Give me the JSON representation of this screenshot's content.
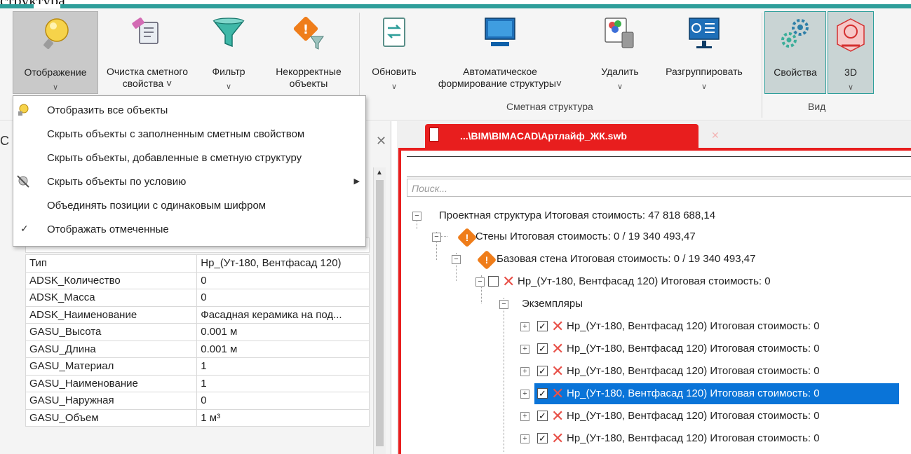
{
  "doc": {
    "partial_text": "структура"
  },
  "ribbon": {
    "buttons": [
      {
        "label": "Отображение",
        "icon": "lightbulb-icon"
      },
      {
        "label": "Очистка сметного",
        "label2": "свойства ˅",
        "icon": "eraser-icon"
      },
      {
        "label": "Фильтр",
        "icon": "filter-icon"
      },
      {
        "label": "Некорректные",
        "label2": "объекты",
        "icon": "warning-filter-icon"
      },
      {
        "label": "Обновить",
        "icon": "refresh-icon"
      },
      {
        "label": "Автоматическое",
        "label2": "формирование структуры˅",
        "icon": "monitor-icon"
      },
      {
        "label": "Удалить",
        "icon": "delete-icon"
      },
      {
        "label": "Разгруппировать",
        "icon": "ungroup-icon"
      },
      {
        "label": "Свойства",
        "icon": "gears-icon"
      },
      {
        "label": "3D",
        "icon": "3d-model-icon"
      }
    ],
    "groups": {
      "estimate_structure": "Сметная структура",
      "view": "Вид"
    }
  },
  "menu": {
    "items": [
      {
        "label": "Отобразить все объекты",
        "icon": "show-all-icon"
      },
      {
        "label": "Скрыть объекты с заполненным сметным свойством"
      },
      {
        "label": "Скрыть объекты, добавленные в сметную структуру"
      },
      {
        "label": "Скрыть объекты по условию",
        "icon": "hide-by-condition-icon",
        "submenu": true
      },
      {
        "label": "Объединять позиции с одинаковым шифром"
      },
      {
        "label": "Отображать отмеченные",
        "checked": true
      }
    ]
  },
  "properties": {
    "title_fragment": "С",
    "rows": [
      {
        "key": "Тип",
        "value": "Нр_(Ут-180, Вентфасад 120)"
      },
      {
        "key": "ADSK_Количество",
        "value": "0"
      },
      {
        "key": "ADSK_Масса",
        "value": "0"
      },
      {
        "key": "ADSK_Наименование",
        "value": "Фасадная керамика на под..."
      },
      {
        "key": "GASU_Высота",
        "value": "0.001 м"
      },
      {
        "key": "GASU_Длина",
        "value": "0.001 м"
      },
      {
        "key": "GASU_Материал",
        "value": "1"
      },
      {
        "key": "GASU_Наименование",
        "value": "1"
      },
      {
        "key": "GASU_Наружная",
        "value": "0"
      },
      {
        "key": "GASU_Объем",
        "value": "1 м³"
      }
    ]
  },
  "document": {
    "tab_title": "...\\BIM\\BIMACAD\\Артлайф_ЖК.swb",
    "search_placeholder": "Поиск...",
    "tree": {
      "root": "Проектная структура Итоговая стоимость: 47 818 688,14",
      "walls": "Стены Итоговая стоимость: 0 / 19 340 493,47",
      "base_wall": "Базовая стена Итоговая стоимость: 0 / 19 340 493,47",
      "type_node": "Нр_(Ут-180, Вентфасад 120) Итоговая стоимость: 0",
      "instances": "Экземпляры",
      "instance_items": [
        "Нр_(Ут-180, Вентфасад 120) Итоговая стоимость: 0",
        "Нр_(Ут-180, Вентфасад 120) Итоговая стоимость: 0",
        "Нр_(Ут-180, Вентфасад 120) Итоговая стоимость: 0",
        "Нр_(Ут-180, Вентфасад 120) Итоговая стоимость: 0",
        "Нр_(Ут-180, Вентфасад 120) Итоговая стоимость: 0",
        "Нр_(Ут-180, Вентфасад 120) Итоговая стоимость: 0"
      ],
      "selected_index": 3
    }
  },
  "colors": {
    "accent_teal": "#2e9e9a",
    "tab_red": "#e81e1e",
    "selection_blue": "#0a74d8",
    "warning_orange": "#ef7d1a"
  }
}
